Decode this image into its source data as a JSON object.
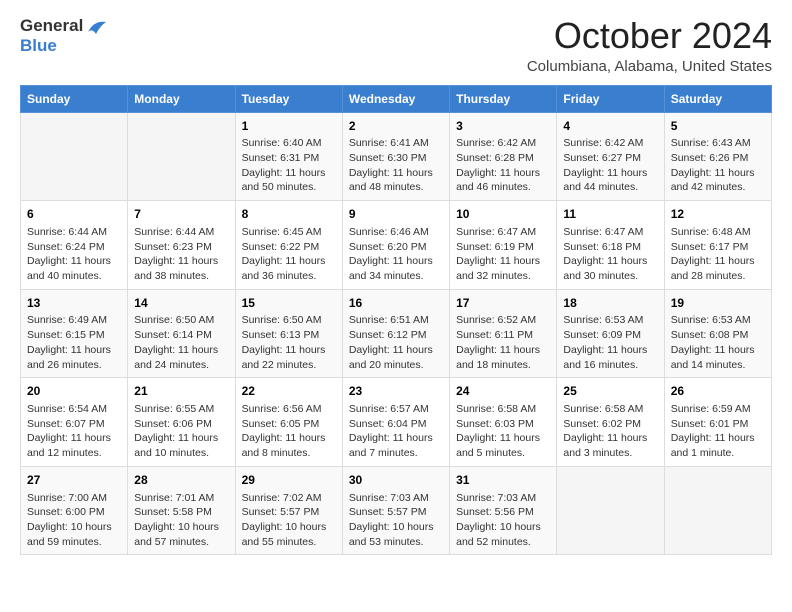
{
  "header": {
    "logo_line1": "General",
    "logo_line2": "Blue",
    "month": "October 2024",
    "location": "Columbiana, Alabama, United States"
  },
  "days_of_week": [
    "Sunday",
    "Monday",
    "Tuesday",
    "Wednesday",
    "Thursday",
    "Friday",
    "Saturday"
  ],
  "weeks": [
    [
      {
        "day": "",
        "info": ""
      },
      {
        "day": "",
        "info": ""
      },
      {
        "day": "1",
        "info": "Sunrise: 6:40 AM\nSunset: 6:31 PM\nDaylight: 11 hours and 50 minutes."
      },
      {
        "day": "2",
        "info": "Sunrise: 6:41 AM\nSunset: 6:30 PM\nDaylight: 11 hours and 48 minutes."
      },
      {
        "day": "3",
        "info": "Sunrise: 6:42 AM\nSunset: 6:28 PM\nDaylight: 11 hours and 46 minutes."
      },
      {
        "day": "4",
        "info": "Sunrise: 6:42 AM\nSunset: 6:27 PM\nDaylight: 11 hours and 44 minutes."
      },
      {
        "day": "5",
        "info": "Sunrise: 6:43 AM\nSunset: 6:26 PM\nDaylight: 11 hours and 42 minutes."
      }
    ],
    [
      {
        "day": "6",
        "info": "Sunrise: 6:44 AM\nSunset: 6:24 PM\nDaylight: 11 hours and 40 minutes."
      },
      {
        "day": "7",
        "info": "Sunrise: 6:44 AM\nSunset: 6:23 PM\nDaylight: 11 hours and 38 minutes."
      },
      {
        "day": "8",
        "info": "Sunrise: 6:45 AM\nSunset: 6:22 PM\nDaylight: 11 hours and 36 minutes."
      },
      {
        "day": "9",
        "info": "Sunrise: 6:46 AM\nSunset: 6:20 PM\nDaylight: 11 hours and 34 minutes."
      },
      {
        "day": "10",
        "info": "Sunrise: 6:47 AM\nSunset: 6:19 PM\nDaylight: 11 hours and 32 minutes."
      },
      {
        "day": "11",
        "info": "Sunrise: 6:47 AM\nSunset: 6:18 PM\nDaylight: 11 hours and 30 minutes."
      },
      {
        "day": "12",
        "info": "Sunrise: 6:48 AM\nSunset: 6:17 PM\nDaylight: 11 hours and 28 minutes."
      }
    ],
    [
      {
        "day": "13",
        "info": "Sunrise: 6:49 AM\nSunset: 6:15 PM\nDaylight: 11 hours and 26 minutes."
      },
      {
        "day": "14",
        "info": "Sunrise: 6:50 AM\nSunset: 6:14 PM\nDaylight: 11 hours and 24 minutes."
      },
      {
        "day": "15",
        "info": "Sunrise: 6:50 AM\nSunset: 6:13 PM\nDaylight: 11 hours and 22 minutes."
      },
      {
        "day": "16",
        "info": "Sunrise: 6:51 AM\nSunset: 6:12 PM\nDaylight: 11 hours and 20 minutes."
      },
      {
        "day": "17",
        "info": "Sunrise: 6:52 AM\nSunset: 6:11 PM\nDaylight: 11 hours and 18 minutes."
      },
      {
        "day": "18",
        "info": "Sunrise: 6:53 AM\nSunset: 6:09 PM\nDaylight: 11 hours and 16 minutes."
      },
      {
        "day": "19",
        "info": "Sunrise: 6:53 AM\nSunset: 6:08 PM\nDaylight: 11 hours and 14 minutes."
      }
    ],
    [
      {
        "day": "20",
        "info": "Sunrise: 6:54 AM\nSunset: 6:07 PM\nDaylight: 11 hours and 12 minutes."
      },
      {
        "day": "21",
        "info": "Sunrise: 6:55 AM\nSunset: 6:06 PM\nDaylight: 11 hours and 10 minutes."
      },
      {
        "day": "22",
        "info": "Sunrise: 6:56 AM\nSunset: 6:05 PM\nDaylight: 11 hours and 8 minutes."
      },
      {
        "day": "23",
        "info": "Sunrise: 6:57 AM\nSunset: 6:04 PM\nDaylight: 11 hours and 7 minutes."
      },
      {
        "day": "24",
        "info": "Sunrise: 6:58 AM\nSunset: 6:03 PM\nDaylight: 11 hours and 5 minutes."
      },
      {
        "day": "25",
        "info": "Sunrise: 6:58 AM\nSunset: 6:02 PM\nDaylight: 11 hours and 3 minutes."
      },
      {
        "day": "26",
        "info": "Sunrise: 6:59 AM\nSunset: 6:01 PM\nDaylight: 11 hours and 1 minute."
      }
    ],
    [
      {
        "day": "27",
        "info": "Sunrise: 7:00 AM\nSunset: 6:00 PM\nDaylight: 10 hours and 59 minutes."
      },
      {
        "day": "28",
        "info": "Sunrise: 7:01 AM\nSunset: 5:58 PM\nDaylight: 10 hours and 57 minutes."
      },
      {
        "day": "29",
        "info": "Sunrise: 7:02 AM\nSunset: 5:57 PM\nDaylight: 10 hours and 55 minutes."
      },
      {
        "day": "30",
        "info": "Sunrise: 7:03 AM\nSunset: 5:57 PM\nDaylight: 10 hours and 53 minutes."
      },
      {
        "day": "31",
        "info": "Sunrise: 7:03 AM\nSunset: 5:56 PM\nDaylight: 10 hours and 52 minutes."
      },
      {
        "day": "",
        "info": ""
      },
      {
        "day": "",
        "info": ""
      }
    ]
  ]
}
